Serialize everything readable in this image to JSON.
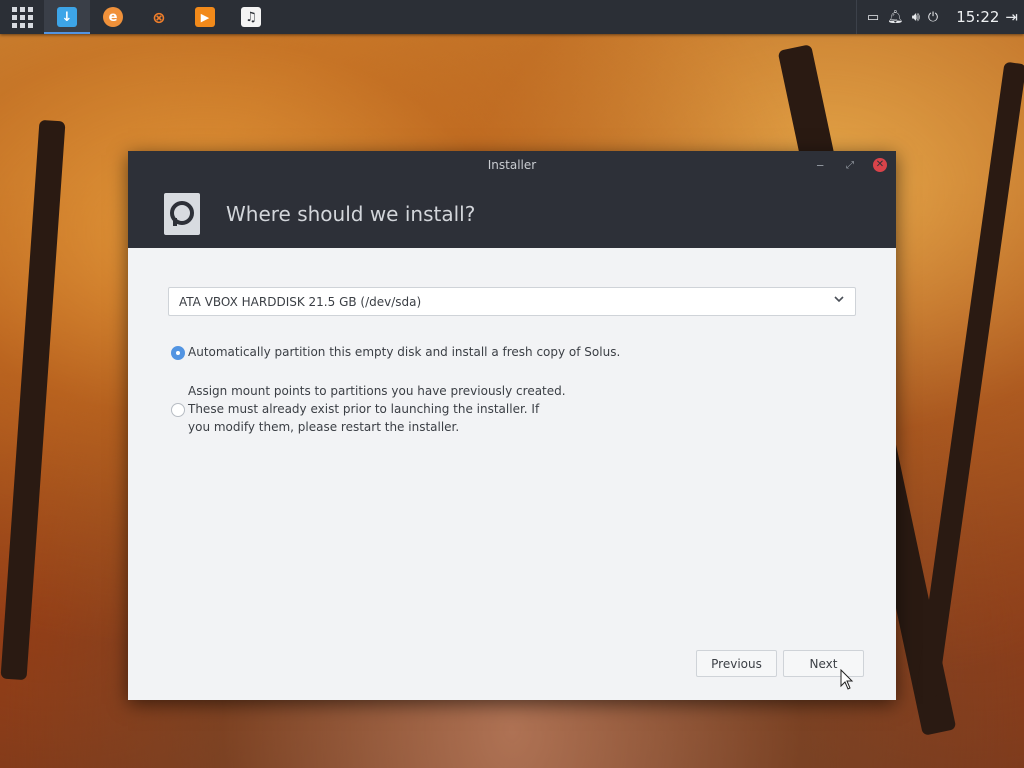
{
  "panel": {
    "apps": [
      {
        "name": "downloads",
        "icon": "download-icon",
        "color": "#3da5e8",
        "glyph": "↓"
      },
      {
        "name": "browser",
        "icon": "firefox-icon",
        "color": "#f0913a",
        "glyph": "e"
      },
      {
        "name": "tools",
        "icon": "chemistry-icon",
        "color": "#f07e2a",
        "glyph": "⊗"
      },
      {
        "name": "media",
        "icon": "play-icon",
        "color": "#f28a1a",
        "glyph": "▶"
      },
      {
        "name": "music",
        "icon": "music-note-icon",
        "color": "#f4f4f4",
        "glyph": "♫"
      }
    ],
    "clock": "15:22"
  },
  "window": {
    "title": "Installer",
    "header": "Where should we install?",
    "disk_select": {
      "value": "ATA VBOX HARDDISK 21.5 GB (/dev/sda)"
    },
    "options": [
      {
        "label": "Automatically partition this empty disk and install a fresh copy of Solus.",
        "checked": true
      },
      {
        "label_lines": [
          "Assign mount points to partitions you have previously created.",
          "These must already exist prior to launching the installer. If",
          "you modify them, please restart the installer."
        ],
        "checked": false
      }
    ],
    "buttons": {
      "previous": "Previous",
      "next": "Next"
    }
  },
  "colors": {
    "accent": "#5294e2",
    "panel": "#2b2f36",
    "header": "#2d3038",
    "close": "#d9434a"
  }
}
